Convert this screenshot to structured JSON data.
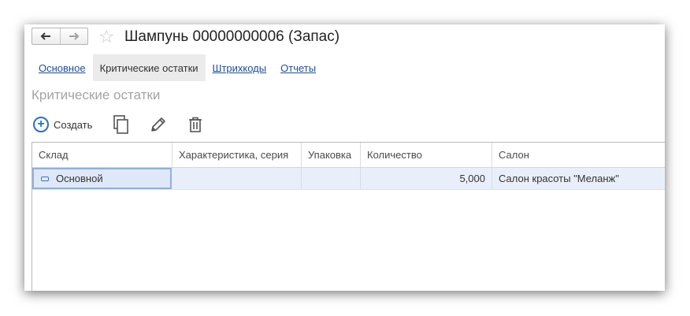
{
  "header": {
    "back_glyph": "🡐",
    "forward_glyph": "🡒",
    "title": "Шампунь 00000000006 (Запас)",
    "favorite_glyph": "☆"
  },
  "tabs": [
    {
      "label": "Основное",
      "active": false
    },
    {
      "label": "Критические остатки",
      "active": true
    },
    {
      "label": "Штрихкоды",
      "active": false
    },
    {
      "label": "Отчеты",
      "active": false
    }
  ],
  "section": {
    "title": "Критические остатки"
  },
  "toolbar": {
    "create_label": "Создать",
    "create_glyph": "+",
    "icons": [
      "copy-icon",
      "edit-pencil-icon",
      "delete-trash-icon"
    ]
  },
  "table": {
    "columns": [
      "Склад",
      "Характеристика, серия",
      "Упаковка",
      "Количество",
      "Салон"
    ],
    "rows": [
      {
        "warehouse": "Основной",
        "characteristic": "",
        "packaging": "",
        "quantity": "5,000",
        "salon": "Салон красоты \"Меланж\""
      }
    ]
  },
  "colors": {
    "accent": "#2c70c0",
    "link": "#1c4f9c",
    "selected_row": "#e9effa",
    "active_tab": "#ebebeb"
  }
}
